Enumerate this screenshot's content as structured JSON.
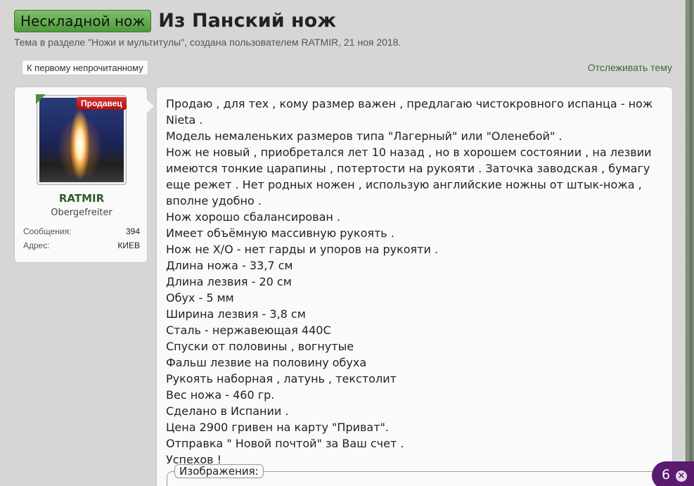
{
  "thread": {
    "prefix": "Нескладной нож",
    "title": "Из Панский нож",
    "meta": "Тема в разделе \"Ножи и мультитулы\", создана пользователем RATMIR, 21 ноя 2018."
  },
  "actions": {
    "first_unread": "К первому непрочитанному",
    "watch": "Отслеживать тему"
  },
  "user": {
    "badge": "Продавец",
    "name": "RATMIR",
    "title": "Obergefreiter",
    "stats": [
      {
        "label": "Сообщения:",
        "value": "394"
      },
      {
        "label": "Адрес:",
        "value": "КИЕВ"
      }
    ]
  },
  "post": {
    "lines": [
      "Продаю , для тех , кому размер важен , предлагаю чистокровного испанца - нож Nieta .",
      "Модель немаленьких размеров типа \"Лагерный\" или \"Оленебой\" .",
      "Нож не новый , приобретался лет 10 назад , но в хорошем состоянии , на лезвии имеются тонкие царапины , потертости на рукояти . Заточка заводская , бумагу еще режет . Нет родных ножен , использую английские ножны от штык-ножа , вполне удобно .",
      "Нож хорошо сбалансирован .",
      "Имеет объёмную массивную рукоять .",
      "Нож не Х/О - нет гарды и упоров на рукояти .",
      "Длина ножа - 33,7 см",
      "Длина лезвия - 20 см",
      "Обух - 5 мм",
      "Ширина лезвия - 3,8 см",
      "Сталь - нержавеющая 440С",
      "Спуски от половины , вогнутые",
      "Фальш лезвие на половину обуха",
      "Рукоять наборная , латунь , текстолит",
      "Вес ножа - 460 гр.",
      "Сделано в Испании .",
      "Цена 2900 гривен на карту \"Приват\".",
      "Отправка \" Новой почтой\" за Ваш счет .",
      "Успехов !"
    ],
    "attachments_label": "Изображения:"
  },
  "notification": {
    "count": "6",
    "close": "×"
  },
  "colors": {
    "prefix_green": "#5fa84a",
    "link_green": "#3c6b32",
    "badge_red": "#c22222",
    "notif_purple": "#5a1a6e"
  }
}
